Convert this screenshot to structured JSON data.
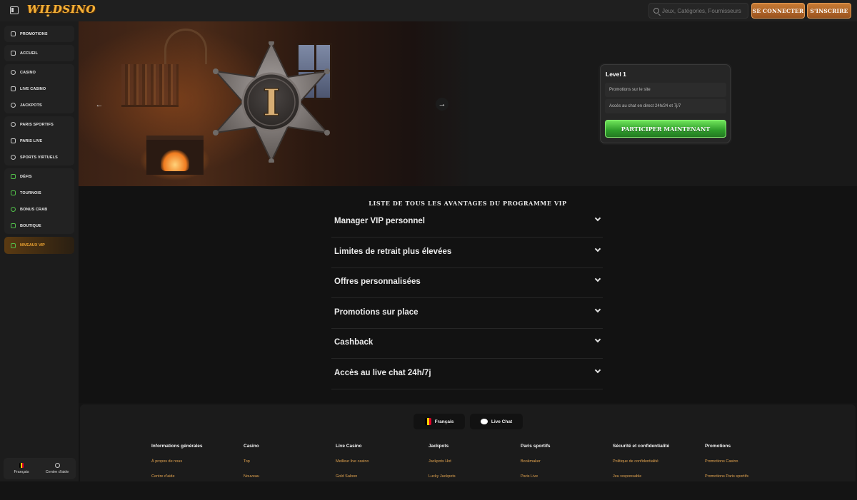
{
  "header": {
    "logo": "WILDSINO",
    "search_placeholder": "Jeux, Catégories, Fournisseurs",
    "login_label": "SE CONNECTER",
    "signup_label": "S'INSCRIRE"
  },
  "sidebar": {
    "promotions": "PROMOTIONS",
    "home": "ACCUEIL",
    "casino": "CASINO",
    "live_casino": "LIVE CASINO",
    "jackpots": "JACKPOTS",
    "sports_betting": "PARIS SPORTIFS",
    "live_betting": "PARIS LIVE",
    "virtual_sports": "SPORTS VIRTUELS",
    "challenges": "DÉFIS",
    "tournaments": "TOURNOIS",
    "bonus_crab": "BONUS CRAB",
    "shop": "BOUTIQUE",
    "vip_levels": "NIVEAUX VIP",
    "language": "Français",
    "help_center": "Centre d'aide"
  },
  "hero": {
    "badge_numeral": "I",
    "level_title": "Level 1",
    "benefits": [
      "Promotions sur le site",
      "Accès au chat en direct 24h/24 et 7j/7"
    ],
    "cta_label": "PARTICIPER MAINTENANT"
  },
  "vip": {
    "title": "LISTE DE TOUS LES AVANTAGES DU PROGRAMME VIP",
    "items": [
      "Manager VIP personnel",
      "Limites de retrait plus élevées",
      "Offres personnalisées",
      "Promotions sur place",
      "Cashback",
      "Accès au live chat 24h/7j"
    ]
  },
  "footer": {
    "language_label": "Français",
    "live_chat_label": "Live Chat",
    "columns": [
      {
        "title": "Informations générales",
        "links": [
          "À propos de nous",
          "Centre d'aide"
        ]
      },
      {
        "title": "Casino",
        "links": [
          "Top",
          "Nouveau"
        ]
      },
      {
        "title": "Live Casino",
        "links": [
          "Meilleur live casino",
          "Gold Saloon"
        ]
      },
      {
        "title": "Jackpots",
        "links": [
          "Jackpots Hot",
          "Lucky Jackpots"
        ]
      },
      {
        "title": "Paris sportifs",
        "links": [
          "Bookmaker",
          "Paris Live"
        ]
      },
      {
        "title": "Sécurité et confidentialité",
        "links": [
          "Politique de confidentialité",
          "Jeu responsable"
        ]
      },
      {
        "title": "Promotions",
        "links": [
          "Promotions Casino",
          "Promotions Paris sportifs"
        ]
      }
    ]
  },
  "colors": {
    "accent_gold": "#f0a632",
    "cta_green": "#2e9c2a",
    "link": "#e0a24e"
  }
}
